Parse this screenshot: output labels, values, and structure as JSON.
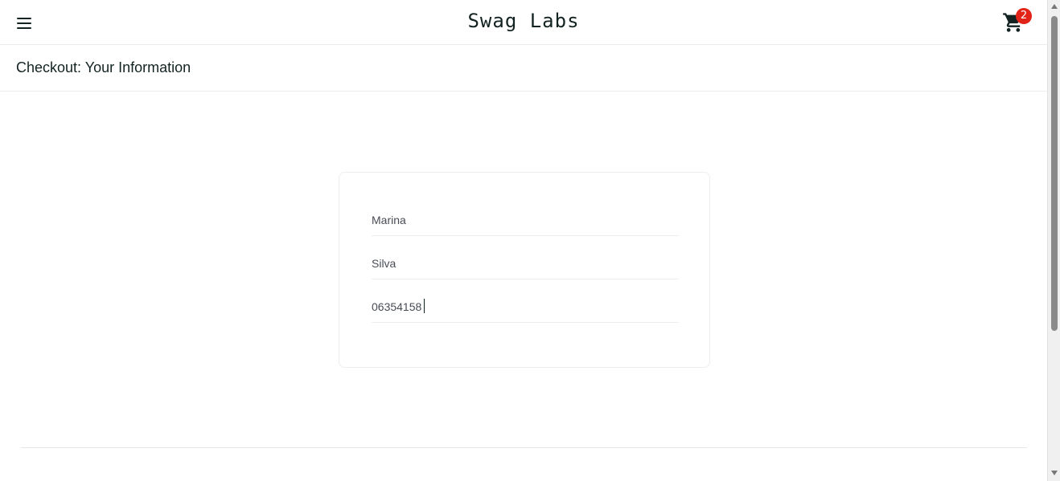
{
  "header": {
    "app_logo": "Swag Labs",
    "menu_icon": "hamburger-menu-icon",
    "cart_icon": "shopping-cart-icon",
    "cart_badge": "2",
    "badge_color": "#e2231a"
  },
  "secondary_header": {
    "title": "Checkout: Your Information"
  },
  "checkout_form": {
    "first_name": {
      "value": "Marina"
    },
    "last_name": {
      "value": "Silva"
    },
    "postal_code": {
      "value": "06354158"
    }
  },
  "colors": {
    "text": "#132322",
    "field_text": "#484c55",
    "border": "#ededed"
  }
}
